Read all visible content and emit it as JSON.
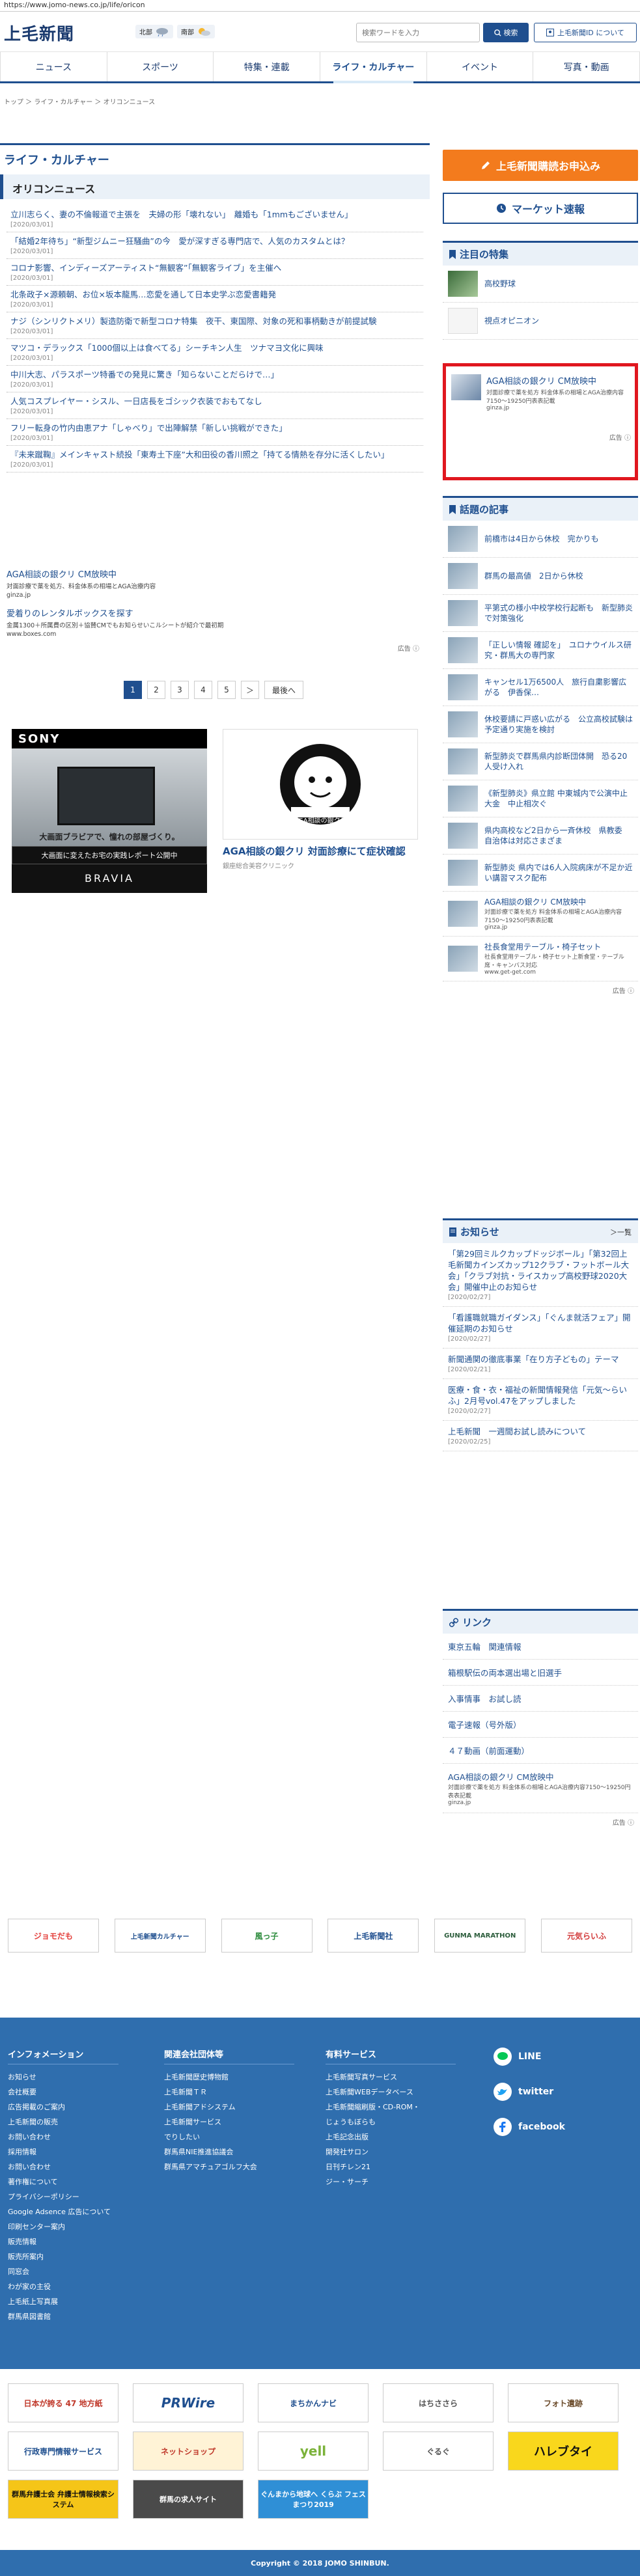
{
  "url": "https://www.jomo-news.co.jp/life/oricon",
  "header": {
    "logo": "上毛新聞",
    "weather": [
      {
        "area": "北部",
        "icon": "cloud-rain-icon"
      },
      {
        "area": "南部",
        "icon": "sun-cloud-icon"
      }
    ],
    "search_placeholder": "検索ワードを入力",
    "search_label": "検索",
    "login_label": "上毛新聞ID について"
  },
  "nav": [
    "ニュース",
    "スポーツ",
    "特集・連載",
    "ライフ・カルチャー",
    "イベント",
    "写真・動画"
  ],
  "nav_active": 3,
  "breadcrumb": "トップ ＞ ライフ・カルチャー ＞ オリコンニュース",
  "section_title": "ライフ・カルチャー",
  "sub_title": "オリコンニュース",
  "articles": [
    {
      "t": "立川志らく、妻の不倫報道で主張を　夫婦の形「壊れない」　離婚も「1mmもございません」",
      "d": "[2020/03/01]"
    },
    {
      "t": "「結婚2年待ち」“新型ジムニー狂騒曲”の今　愛が深すぎる専門店で、人気のカスタムとは？",
      "d": "[2020/03/01]"
    },
    {
      "t": "コロナ影響、インディーズアーティスト“無観客”「無観客ライブ」を主催へ",
      "d": "[2020/03/01]"
    },
    {
      "t": "北条政子×源頼朝、お位×坂本龍馬…恋愛を通して日本史学ぶ恋愛書籍発",
      "d": "[2020/03/01]"
    },
    {
      "t": "ナジ（シンリクトメリ）製造防衛で新型コロナ特集　夜干、東国際、対象の死和事柄動きが前提試験",
      "d": "[2020/03/01]"
    },
    {
      "t": "マツコ・デラックス「1000個以上は食べてる」シーチキン人生　ツナマヨ文化に興味",
      "d": "[2020/03/01]"
    },
    {
      "t": "中川大志、パラスポーツ特番での発見に驚き「知らないことだらけで…」",
      "d": "[2020/03/01]"
    },
    {
      "t": "人気コスプレイヤー・シスル、一日店長をゴシック衣装でおもてなし",
      "d": "[2020/03/01]"
    },
    {
      "t": "フリー転身の竹内由恵アナ「しゃべり」で出陣解禁「新しい挑戦ができた」",
      "d": "[2020/03/01]"
    },
    {
      "t": "『未来蹴鞠』メインキャスト続投「東寿土下座”大和田役の香川照之「持てる情熱を存分に活くしたい」",
      "d": "[2020/03/01]"
    }
  ],
  "inline_ads": [
    {
      "t": "AGA相談の銀クリ CM放映中",
      "s": "対面診療で薬を処方、料金体系の相場とAGA治療内容",
      "src": "ginza.jp"
    },
    {
      "t": "愛着りのレンタルボックスを探す",
      "s": "金属1300＋所属費の区別＋協賛CMでもお知らせいこルシートが紹介で最初期",
      "src": "www.boxes.com"
    }
  ],
  "ad_label": "広告",
  "pager": [
    "1",
    "2",
    "3",
    "4",
    "5",
    "＞",
    "最後へ"
  ],
  "sony_ad": {
    "brand": "SONY",
    "caption1": "大画面ブラビアで、憧れの部屋づくり。",
    "caption2": "大画面に変えたお宅の実践レポート公開中",
    "product": "BRAVIA"
  },
  "aga_ad": {
    "title": "AGA相談の銀クリ 対面診療にて症状確認",
    "sub": "銀座総合美容クリニック",
    "label": "AGA相談の銀クリ"
  },
  "side": {
    "subscribe": "上毛新聞購読お申込み",
    "market": "マーケット速報",
    "feature_title": "注目の特集",
    "features": [
      {
        "t": "高校野球"
      },
      {
        "t": "視点オピニオン"
      }
    ],
    "red_ad": {
      "t": "AGA相談の銀クリ CM放映中",
      "s": "対面診療で薬を処方 料金体系の相場とAGA治療内容7150〜19250円表表記載",
      "src": "ginza.jp"
    },
    "topics_title": "話題の記事",
    "topics": [
      "前橋市は4日から休校　完かりも",
      "群馬の最高値　2日から休校",
      "平第式の様小中校学校行起断も　新型肺炎で対策強化",
      "「正しい情報 確認を」　ユロナウイルス研究・群馬大の専門家",
      "キャンセル1万6500人　旅行自粛影響広がる　伊香保…",
      "休校要請に戸惑い広がる　公立高校試験は予定通り実施を検討",
      "新型肺炎で群馬県内診断団体開　恐る20人受け入れ",
      "《新型肺炎》県立館 中東城内で公演中止 大金　中止相次ぐ",
      "県内高校など2日から一斉休校　県教委　自治体は対応さまざま",
      "新型肺炎 県内では6人入院病床が不足か近い講習マスク配布",
      "AGA相談の銀クリ CM放映中",
      "社長食堂用テーブル・椅子セット"
    ],
    "topic_ad_sub": "対面診療で薬を処方 料金体系の相場とAGA治療内容7150〜19250円表表記載",
    "topic_ad_src": "ginza.jp",
    "table_sub": "社長食堂用テーブル・椅子セット上新食堂・テーブル席・キャンバス対応",
    "table_src": "www.get-get.com",
    "notice_title": "お知らせ",
    "notice_more": "＞一覧",
    "notices": [
      {
        "t": "「第29回ミルクカップドッジボール」「第32回上毛新聞カインズカップ12クラブ・フットボール大会」「クラブ対抗・ライスカップ高校野球2020大会」開催中止のお知らせ",
        "d": "[2020/02/27]"
      },
      {
        "t": "「看護職就職ガイダンス」「ぐんま就活フェア」開催延期のお知らせ",
        "d": "[2020/02/27]"
      },
      {
        "t": "新聞通関の徹底事業「在り方子どもの」テーマ",
        "d": "[2020/02/21]"
      },
      {
        "t": "医療・食・衣・福祉の新聞情報発信「元気～らいふ」2月号vol.47をアップしました",
        "d": "[2020/02/27]"
      },
      {
        "t": "上毛新聞　一週間お試し読みについて",
        "d": "[2020/02/25]"
      }
    ],
    "link_title": "リンク",
    "links": [
      "東京五輪　関連情報",
      "箱根駅伝の両本選出場と旧選手",
      "入事情事　お試し読",
      "電子速報（号外版）",
      "４７動画（前面運動）",
      "AGA相談の銀クリ CM放映中"
    ],
    "link_ad_sub": "対面診療で薬を処方 料金体系の相場とAGA治療内容7150〜19250円表表記載",
    "link_ad_src": "ginza.jp"
  },
  "banners": [
    "ジョモだも",
    "上毛新聞カルチャー",
    "風っ子",
    "上毛新聞社",
    "GUNMA MARATHON",
    "元気らいふ"
  ],
  "footer": {
    "col1_title": "インフォメーション",
    "col1": [
      "お知らせ",
      "会社概要",
      "広告掲載のご案内",
      "上毛新聞の販売",
      "お問い合わせ",
      "採用情報",
      "お問い合わせ",
      "著作権について",
      "プライバシーポリシー",
      "Google Adsence 広告について",
      "印刷センター案内",
      "販売情報",
      "販売所案内",
      "同窓会",
      "わが家の主役",
      "上毛紙上写真展",
      "群馬県図書館"
    ],
    "col2_title": "関連会社団体等",
    "col2": [
      "上毛新聞歴史博物館",
      "上毛新聞ＴＲ",
      "上毛新聞アドシステム",
      "上毛新聞サービス",
      "でりしたい",
      "群馬県NIE推進協議会",
      "群馬県アマチュアゴルフ大会"
    ],
    "col3_title": "有料サービス",
    "col3": [
      "上毛新聞写真サービス",
      "上毛新聞WEBデータベース",
      "上毛新聞縮刷版・CD-ROM・",
      "じょうもぼらも",
      "上毛記念出版",
      "開発社サロン",
      "日刊チレン21",
      "ジー・サーチ"
    ],
    "social": [
      "LINE",
      "twitter",
      "facebook"
    ]
  },
  "foot_ads": [
    "日本が誇る 47 地方紙",
    "PRWire",
    "まちかんナビ",
    "はちささら",
    "フォト遺跡",
    "行政専門情報サービス",
    "ネットショップ",
    "yell",
    "ぐるぐ",
    "ハレブタイ",
    "群馬弁護士会 弁護士情報検索システム",
    "群馬の求人サイト",
    "ぐんまから地球へ くらぶ フェスまつり2019"
  ],
  "copyright": "Copyright © 2018 JOMO SHINBUN."
}
